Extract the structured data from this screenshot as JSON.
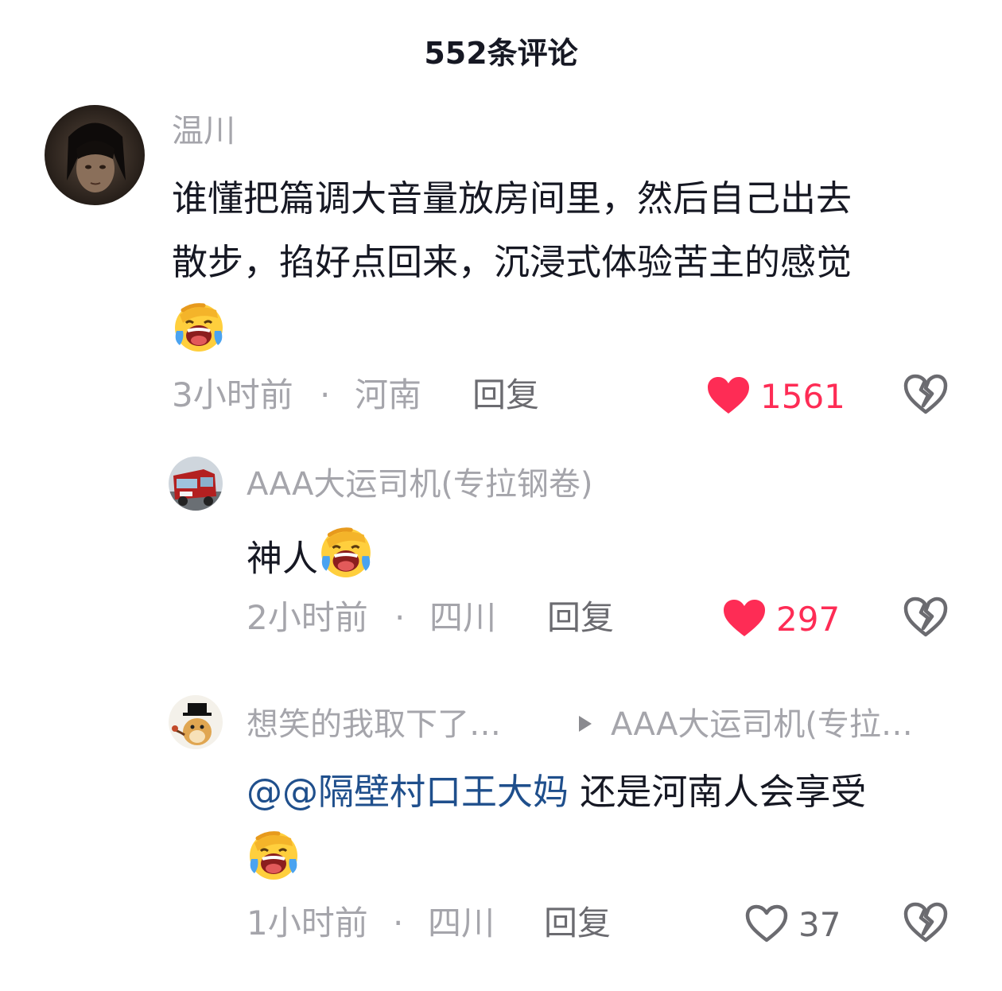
{
  "header": {
    "title": "552条评论"
  },
  "colors": {
    "liked_red": "#fe2c55",
    "muted_text": "#a5a5ab",
    "mention_blue": "#1f4f8c",
    "body_text": "#161823"
  },
  "comments": [
    {
      "username": "温川",
      "text_lines": [
        "谁懂把篇调大音量放房间里，然后自己出去",
        "散步，掐好点回来，沉浸式体验苦主的感觉"
      ],
      "emoji": "laughing-crying-emoji",
      "time": "3小时前",
      "location": "河南",
      "reply_label": "回复",
      "like_count": "1561",
      "liked": true
    },
    {
      "username": "AAA大运司机(专拉钢卷)",
      "text": "神人",
      "emoji": "laughing-crying-emoji",
      "time": "2小时前",
      "location": "四川",
      "reply_label": "回复",
      "like_count": "297",
      "liked": true
    },
    {
      "username": "想笑的我取下了…",
      "reply_to": "AAA大运司机(专拉…",
      "mention": "@@隔壁村口王大妈",
      "text": " 还是河南人会享受",
      "emoji": "laughing-crying-emoji",
      "time": "1小时前",
      "location": "四川",
      "reply_label": "回复",
      "like_count": "37",
      "liked": false
    }
  ],
  "separator": "·"
}
